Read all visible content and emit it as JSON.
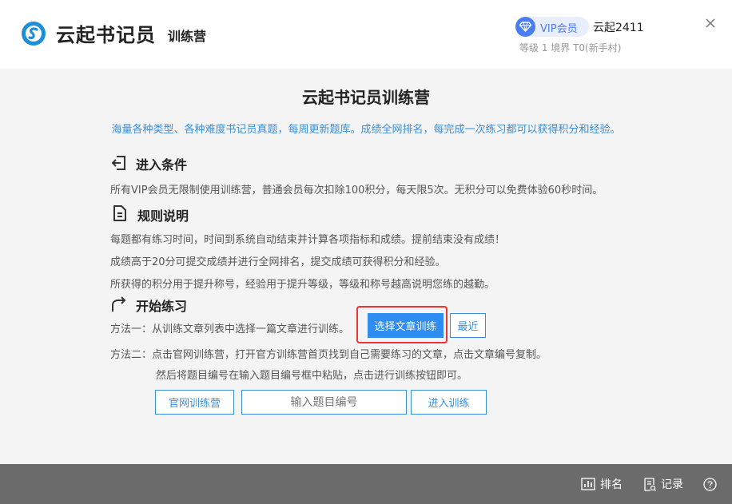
{
  "header": {
    "brand": "云起书记员",
    "brand_sub": "训练营",
    "vip_label": "VIP会员",
    "user_name": "云起2411",
    "user_level": "等级 1 境界 T0(新手村)"
  },
  "main": {
    "title": "云起书记员训练营",
    "subtitle": "海量各种类型、各种难度书记员真题，每周更新题库。成绩全网排名，每完成一次练习都可以获得积分和经验。"
  },
  "sections": {
    "entry": {
      "title": "进入条件",
      "text": "所有VIP会员无限制使用训练营，普通会员每次扣除100积分，每天限5次。无积分可以免费体验60秒时间。"
    },
    "rules": {
      "title": "规则说明",
      "lines": [
        "每题都有练习时间，时间到系统自动结束并计算各项指标和成绩。提前结束没有成绩！",
        "成绩高于20分可提交成绩并进行全网排名，提交成绩可获得积分和经验。",
        "所获得的积分用于提升称号，经验用于提升等级，等级和称号越高说明您练的越勤。"
      ]
    },
    "start": {
      "title": "开始练习",
      "method1": "方法一：从训练文章列表中选择一篇文章进行训练。",
      "select_btn": "选择文章训练",
      "recent_btn": "最近",
      "method2": "方法二：点击官网训练营，打开官方训练营首页找到自己需要练习的文章，点击文章编号复制。",
      "method2_cont": "然后将题目编号在输入题目编号框中粘贴，点击进行训练按钮即可。",
      "official_btn": "官网训练营",
      "input_placeholder": "输入题目编号",
      "enter_btn": "进入训练"
    }
  },
  "footer": {
    "rank_label": "排名",
    "record_label": "记录"
  },
  "colors": {
    "accent": "#2f8cf0",
    "link_blue": "#3b8fd9",
    "highlight_red": "#e33",
    "footer_bg": "#6b6b6b"
  }
}
